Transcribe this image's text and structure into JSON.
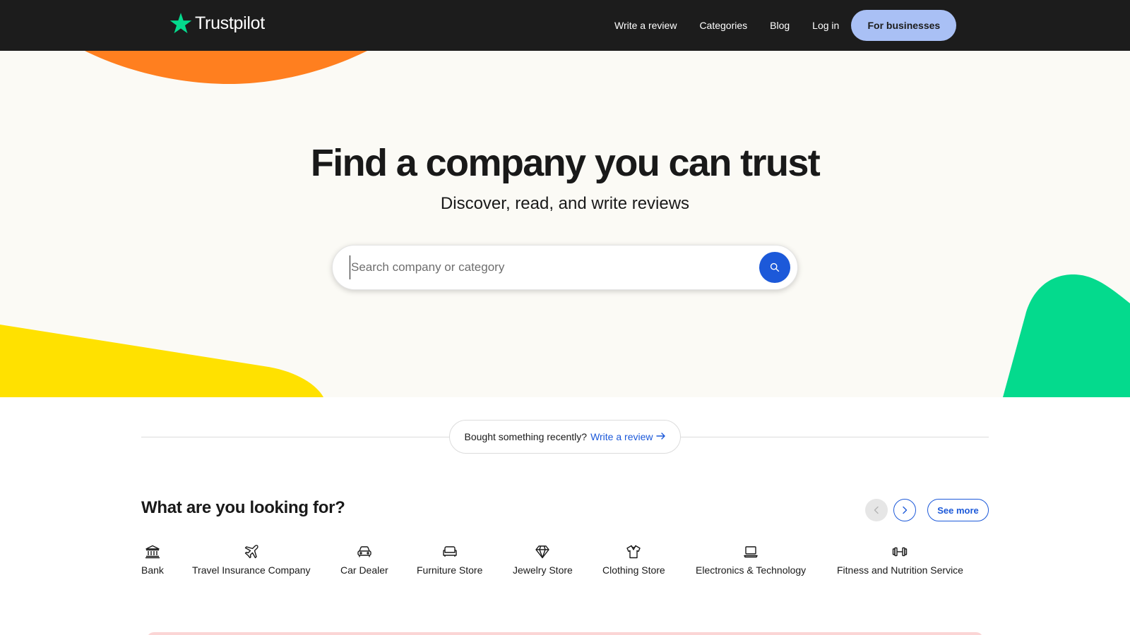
{
  "header": {
    "logo_text": "Trustpilot",
    "nav": {
      "write_review": "Write a review",
      "categories": "Categories",
      "blog": "Blog",
      "login": "Log in",
      "for_businesses": "For businesses"
    }
  },
  "hero": {
    "title": "Find a company you can trust",
    "subtitle": "Discover, read, and write reviews",
    "search": {
      "placeholder": "Search company or category",
      "value": ""
    }
  },
  "bought_banner": {
    "text": "Bought something recently?",
    "link": "Write a review"
  },
  "categories_section": {
    "title": "What are you looking for?",
    "see_more": "See more",
    "items": [
      {
        "label": "Bank",
        "icon": "bank-icon"
      },
      {
        "label": "Travel Insurance Company",
        "icon": "airplane-icon"
      },
      {
        "label": "Car Dealer",
        "icon": "car-icon"
      },
      {
        "label": "Furniture Store",
        "icon": "sofa-icon"
      },
      {
        "label": "Jewelry Store",
        "icon": "diamond-icon"
      },
      {
        "label": "Clothing Store",
        "icon": "tshirt-icon"
      },
      {
        "label": "Electronics & Technology",
        "icon": "laptop-icon"
      },
      {
        "label": "Fitness and Nutrition Service",
        "icon": "dumbbell-icon"
      }
    ]
  },
  "colors": {
    "header_bg": "#1c1c1c",
    "hero_bg": "#fbfaf5",
    "brand_green": "#04da8d",
    "accent_blue": "#1c59d9",
    "business_button": "#a9c0f5",
    "orange_shape": "#ff7f1f",
    "yellow_shape": "#ffe100",
    "green_shape": "#04da8d"
  }
}
